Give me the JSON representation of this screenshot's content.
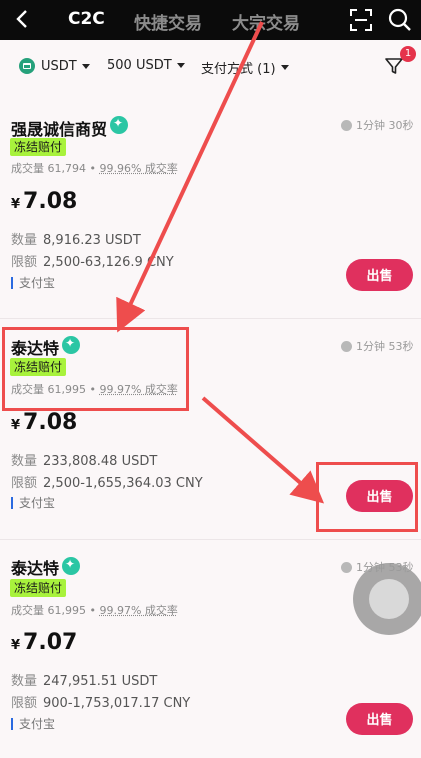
{
  "header": {
    "tabs": [
      "C2C",
      "快捷交易",
      "大宗交易"
    ]
  },
  "filters": {
    "coin": "USDT",
    "amount": "500 USDT",
    "payment": "支付方式 (1)",
    "badge_count": "1"
  },
  "listings": [
    {
      "merchant": "强晟诚信商贸",
      "tag": "冻结赔付",
      "volume": "成交量 61,794",
      "rate": "99.96% 成交率",
      "time": "1分钟 30秒",
      "currency_symbol": "¥",
      "price": "7.08",
      "quantity_label": "数量",
      "quantity": "8,916.23 USDT",
      "limit_label": "限额",
      "limit": "2,500-63,126.9 CNY",
      "payment": "支付宝",
      "action": "出售"
    },
    {
      "merchant": "泰达特",
      "tag": "冻结赔付",
      "volume": "成交量 61,995",
      "rate": "99.97% 成交率",
      "time": "1分钟 53秒",
      "currency_symbol": "¥",
      "price": "7.08",
      "quantity_label": "数量",
      "quantity": "233,808.48 USDT",
      "limit_label": "限额",
      "limit": "2,500-1,655,364.03 CNY",
      "payment": "支付宝",
      "action": "出售"
    },
    {
      "merchant": "泰达特",
      "tag": "冻结赔付",
      "volume": "成交量 61,995",
      "rate": "99.97% 成交率",
      "time": "1分钟 53秒",
      "currency_symbol": "¥",
      "price": "7.07",
      "quantity_label": "数量",
      "quantity": "247,951.51 USDT",
      "limit_label": "限额",
      "limit": "900-1,753,017.17 CNY",
      "payment": "支付宝",
      "action": "出售"
    }
  ],
  "colors": {
    "sell_button": "#e0305e",
    "tag": "#a8f23c",
    "annotation": "#ee4d4d"
  }
}
